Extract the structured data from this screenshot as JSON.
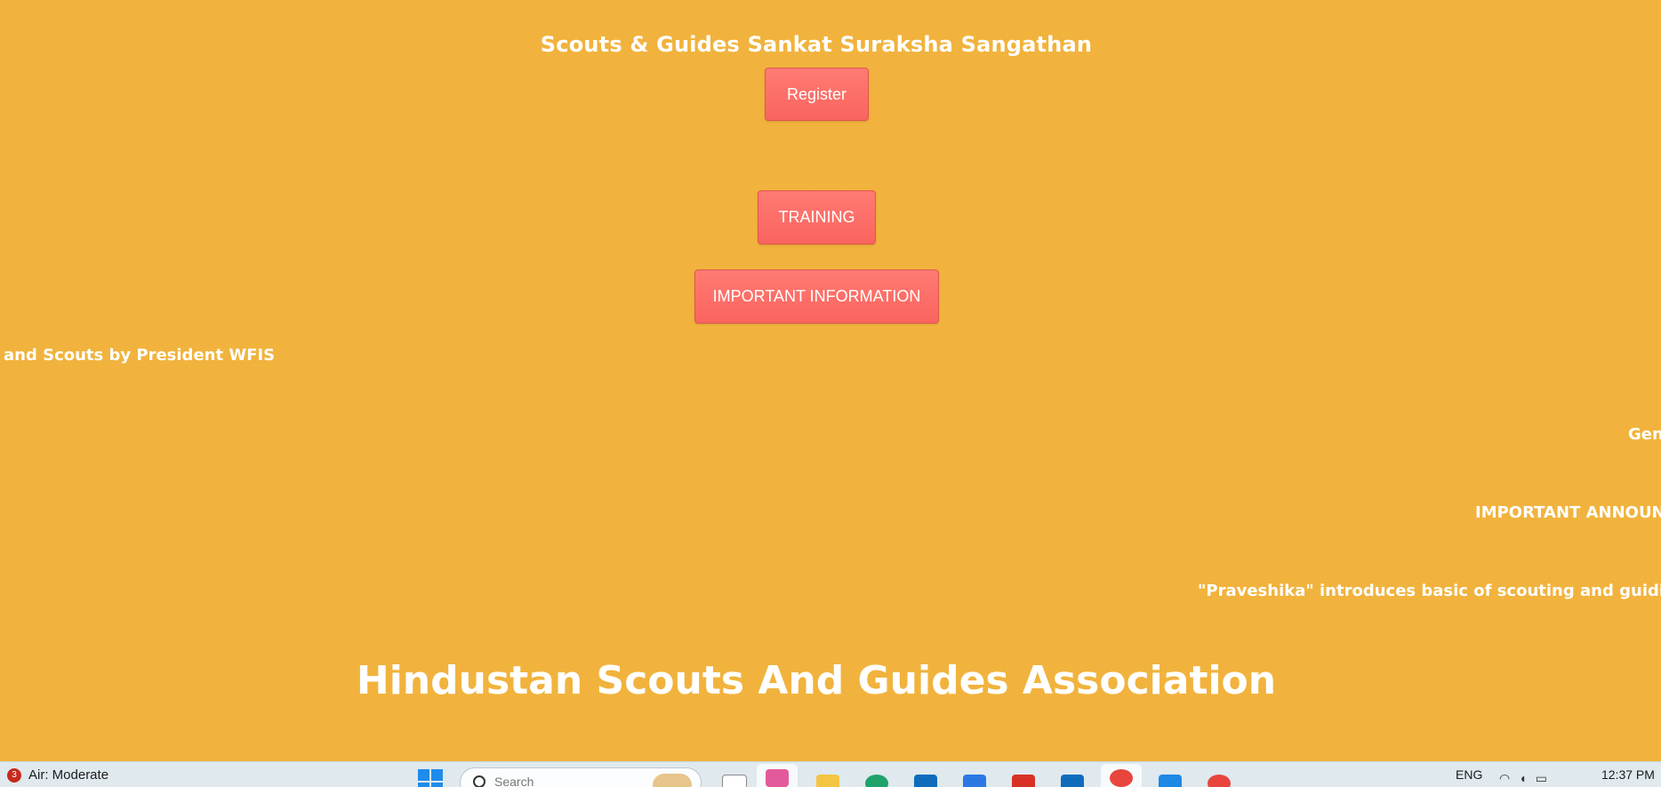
{
  "header": {
    "site_title": "Scouts & Guides Sankat Suraksha Sangathan"
  },
  "buttons": {
    "register": "Register",
    "training": "TRAINING",
    "important_information": "IMPORTANT INFORMATION"
  },
  "tickers": [
    {
      "text": "and Scouts by President WFIS"
    },
    {
      "text": "Gen"
    },
    {
      "text": "IMPORTANT ANNOUNC"
    },
    {
      "text": "\"Praveshika\" introduces basic of scouting and guiding fo"
    }
  ],
  "hero": {
    "title": "Hindustan Scouts And Guides Association"
  },
  "taskbar": {
    "weather_badge": "3",
    "weather_text": "Air: Moderate",
    "search_placeholder": "Search",
    "language": "ENG",
    "time": "12:37 PM",
    "apps": [
      {
        "icon": "copilot-icon",
        "color": "#e35a9a"
      },
      {
        "icon": "file-explorer-icon",
        "color": "#f4c542"
      },
      {
        "icon": "edge-icon",
        "color": "#1fa36b"
      },
      {
        "icon": "store-icon",
        "color": "#0f6cbd"
      },
      {
        "icon": "app-icon",
        "color": "#2b78e4"
      },
      {
        "icon": "gmail-icon",
        "color": "#d93025"
      },
      {
        "icon": "mail-icon",
        "color": "#0f6cbd"
      },
      {
        "icon": "chrome-icon",
        "color": "#e8453c"
      },
      {
        "icon": "vscode-icon",
        "color": "#1e88e5"
      },
      {
        "icon": "chrome-icon",
        "color": "#e8453c"
      }
    ]
  },
  "colors": {
    "background": "#f1b33d",
    "button": "#fa645e",
    "text": "#ffffff"
  }
}
